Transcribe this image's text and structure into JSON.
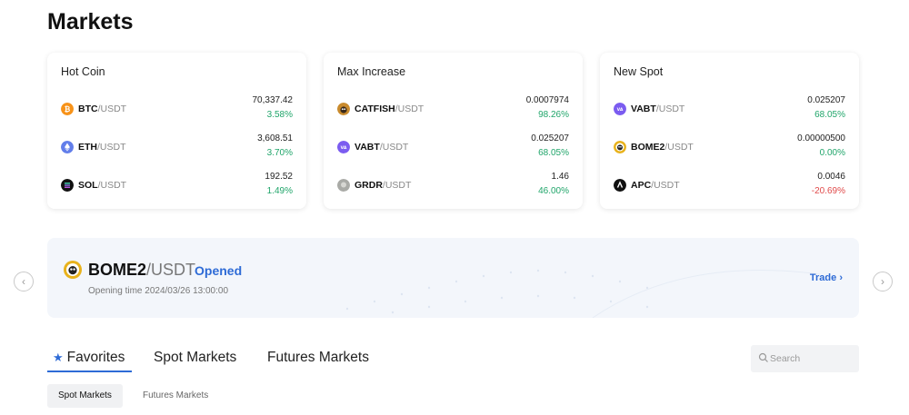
{
  "page": {
    "title": "Markets"
  },
  "cards": [
    {
      "title": "Hot Coin",
      "rows": [
        {
          "base": "BTC",
          "quote": "/USDT",
          "price": "70,337.42",
          "change": "3.58%",
          "direction": "up",
          "icon": "bitcoin-icon",
          "icon_color": "#f7931a"
        },
        {
          "base": "ETH",
          "quote": "/USDT",
          "price": "3,608.51",
          "change": "3.70%",
          "direction": "up",
          "icon": "ethereum-icon",
          "icon_color": "#627eea"
        },
        {
          "base": "SOL",
          "quote": "/USDT",
          "price": "192.52",
          "change": "1.49%",
          "direction": "up",
          "icon": "solana-icon",
          "icon_color": "#111111"
        }
      ]
    },
    {
      "title": "Max Increase",
      "rows": [
        {
          "base": "CATFISH",
          "quote": "/USDT",
          "price": "0.0007974",
          "change": "98.26%",
          "direction": "up",
          "icon": "catfish-icon",
          "icon_color": "#c98b2e"
        },
        {
          "base": "VABT",
          "quote": "/USDT",
          "price": "0.025207",
          "change": "68.05%",
          "direction": "up",
          "icon": "vabt-icon",
          "icon_color": "#7b5cf0"
        },
        {
          "base": "GRDR",
          "quote": "/USDT",
          "price": "1.46",
          "change": "46.00%",
          "direction": "up",
          "icon": "grdr-icon",
          "icon_color": "#a9aaa6"
        }
      ]
    },
    {
      "title": "New Spot",
      "rows": [
        {
          "base": "VABT",
          "quote": "/USDT",
          "price": "0.025207",
          "change": "68.05%",
          "direction": "up",
          "icon": "vabt-icon",
          "icon_color": "#7b5cf0"
        },
        {
          "base": "BOME2",
          "quote": "/USDT",
          "price": "0.00000500",
          "change": "0.00%",
          "direction": "up",
          "icon": "bome2-icon",
          "icon_color": "#e8b21c"
        },
        {
          "base": "APC",
          "quote": "/USDT",
          "price": "0.0046",
          "change": "-20.69%",
          "direction": "down",
          "icon": "apc-icon",
          "icon_color": "#111111"
        }
      ]
    }
  ],
  "banner": {
    "base": "BOME2",
    "quote": "/USDT",
    "status": "Opened",
    "time": "Opening time 2024/03/26 13:00:00",
    "trade_label": "Trade",
    "icon": "bome2-icon"
  },
  "tabs": {
    "items": [
      {
        "label": "Favorites",
        "icon": "star-icon",
        "active": true
      },
      {
        "label": "Spot Markets",
        "active": false
      },
      {
        "label": "Futures Markets",
        "active": false
      }
    ]
  },
  "search": {
    "placeholder": "Search",
    "value": ""
  },
  "subtabs": {
    "items": [
      {
        "label": "Spot Markets",
        "active": true
      },
      {
        "label": "Futures Markets",
        "active": false
      }
    ]
  },
  "colors": {
    "accent": "#2e6bd6",
    "up": "#20a56a",
    "down": "#e04a4a"
  }
}
